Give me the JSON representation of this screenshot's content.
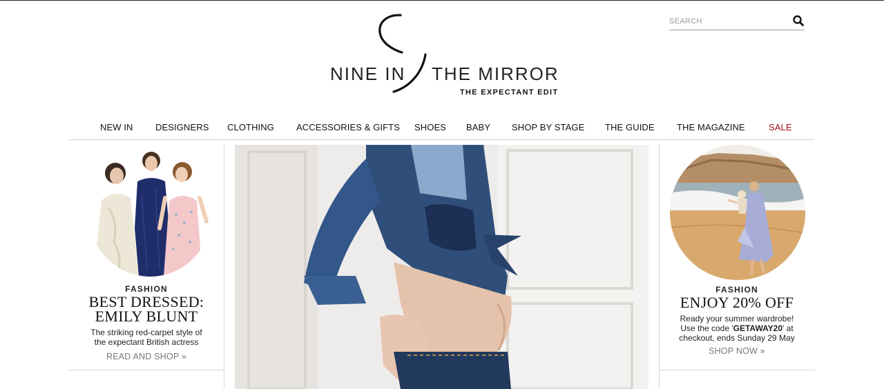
{
  "search": {
    "placeholder": "SEARCH",
    "icon": "search-icon"
  },
  "brand": {
    "name_part1": "NINE IN",
    "name_part2": "THE MIRROR",
    "tagline": "THE EXPECTANT EDIT"
  },
  "nav": {
    "items": [
      {
        "label": "NEW IN"
      },
      {
        "label": "DESIGNERS"
      },
      {
        "label": "CLOTHING"
      },
      {
        "label": "ACCESSORIES & GIFTS"
      },
      {
        "label": "SHOES"
      },
      {
        "label": "BABY"
      },
      {
        "label": "SHOP BY STAGE"
      },
      {
        "label": "THE GUIDE"
      },
      {
        "label": "THE MAGAZINE"
      },
      {
        "label": "SALE",
        "color": "#a00e1c"
      }
    ]
  },
  "left_promo": {
    "kicker": "FASHION",
    "headline_line1": "BEST DRESSED:",
    "headline_line2": "EMILY BLUNT",
    "blurb_line1": "The striking red-carpet style of",
    "blurb_line2": "the expectant British actress",
    "cta": "READ AND SHOP »"
  },
  "right_promo": {
    "kicker": "FASHION",
    "headline": "ENJOY 20% OFF",
    "blurb_line1": "Ready your summer wardrobe!",
    "blurb_pre": "Use the code '",
    "blurb_code": "GETAWAY20",
    "blurb_post": "' at",
    "blurb_line3": "checkout, ends Sunday 29 May",
    "cta": "SHOP NOW »"
  },
  "colors": {
    "sale": "#a00e1c",
    "text": "#111111",
    "divider": "#d6d6d6"
  }
}
